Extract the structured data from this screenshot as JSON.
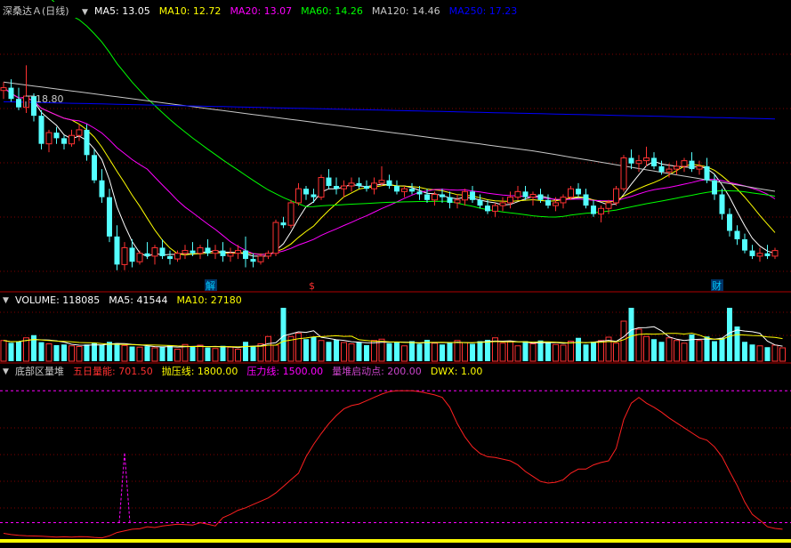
{
  "header": {
    "stock": "深桑达Ａ(日线)",
    "ma_labels": [
      {
        "label": "MA5: 13.05",
        "color": "#ffffff"
      },
      {
        "label": "MA10: 12.72",
        "color": "#ffff00"
      },
      {
        "label": "MA20: 13.07",
        "color": "#ff00ff"
      },
      {
        "label": "MA60: 14.26",
        "color": "#00ff00"
      },
      {
        "label": "MA120: 14.46",
        "color": "#c8c8c8"
      },
      {
        "label": "MA250: 17.23",
        "color": "#0000ff"
      }
    ]
  },
  "volume_header": [
    {
      "label": "VOLUME: 118085",
      "color": "#ffffff"
    },
    {
      "label": "MA5: 41544",
      "color": "#ffffff"
    },
    {
      "label": "MA10: 27180",
      "color": "#ffff00"
    }
  ],
  "indicator_header": [
    {
      "label": "底部区量堆",
      "color": "#c8c8c8"
    },
    {
      "label": "五日量能: 701.50",
      "color": "#ff3030"
    },
    {
      "label": "抛压线: 1800.00",
      "color": "#ffff00"
    },
    {
      "label": "压力线: 1500.00",
      "color": "#ff00ff"
    },
    {
      "label": "量堆启动点: 200.00",
      "color": "#cc44cc"
    },
    {
      "label": "DWX: 1.00",
      "color": "#ffff00"
    }
  ],
  "markers": [
    {
      "label": "解",
      "color": "#00ccff"
    },
    {
      "label": "$",
      "color": "#ff3030"
    },
    {
      "label": "财",
      "color": "#00ccff"
    }
  ],
  "colors": {
    "up": "#ff3232",
    "down": "#54ffff",
    "ma5": "#ffffff",
    "ma10": "#ffff00",
    "ma20": "#ff00ff",
    "ma60": "#00ff00",
    "ma120": "#c8c8c8",
    "ma250": "#0000ff",
    "grid": "#800000",
    "energy": "#ff2020",
    "pressure": "#ff00ff",
    "dwx": "#ffff00"
  },
  "chart_data": {
    "type": "candlestick",
    "high_label": "18.80",
    "price_ylim": [
      11.3,
      20.3
    ],
    "ohlc": [
      [
        17.9,
        18.2,
        17.6,
        18.0
      ],
      [
        18.0,
        18.3,
        17.5,
        17.6
      ],
      [
        17.6,
        18.0,
        17.2,
        17.3
      ],
      [
        17.3,
        18.8,
        17.1,
        17.7
      ],
      [
        17.7,
        17.8,
        16.8,
        17.0
      ],
      [
        17.0,
        17.2,
        15.8,
        16.0
      ],
      [
        16.0,
        16.5,
        15.7,
        16.4
      ],
      [
        16.4,
        16.6,
        16.0,
        16.2
      ],
      [
        16.2,
        16.3,
        15.8,
        16.0
      ],
      [
        16.0,
        16.5,
        15.9,
        16.3
      ],
      [
        16.3,
        16.7,
        16.1,
        16.5
      ],
      [
        16.5,
        16.7,
        15.4,
        15.6
      ],
      [
        15.6,
        15.8,
        14.6,
        14.7
      ],
      [
        14.7,
        15.1,
        13.9,
        14.1
      ],
      [
        14.1,
        14.4,
        12.5,
        12.7
      ],
      [
        12.7,
        13.1,
        11.5,
        11.7
      ],
      [
        11.7,
        12.5,
        11.5,
        12.3
      ],
      [
        12.3,
        12.6,
        11.6,
        11.8
      ],
      [
        11.8,
        12.2,
        11.7,
        12.1
      ],
      [
        12.1,
        12.5,
        11.9,
        12.0
      ],
      [
        12.0,
        12.4,
        11.7,
        12.3
      ],
      [
        12.3,
        12.6,
        11.9,
        12.0
      ],
      [
        12.0,
        12.2,
        11.7,
        11.9
      ],
      [
        11.9,
        12.2,
        11.8,
        12.1
      ],
      [
        12.1,
        12.4,
        11.9,
        12.2
      ],
      [
        12.2,
        12.5,
        12.0,
        12.1
      ],
      [
        12.1,
        12.4,
        11.9,
        12.3
      ],
      [
        12.3,
        12.6,
        12.0,
        12.1
      ],
      [
        12.1,
        12.4,
        11.9,
        12.2
      ],
      [
        12.2,
        12.5,
        11.8,
        12.0
      ],
      [
        12.0,
        12.3,
        11.8,
        12.1
      ],
      [
        12.1,
        12.4,
        11.9,
        12.2
      ],
      [
        12.2,
        12.7,
        11.6,
        11.9
      ],
      [
        11.9,
        12.1,
        11.6,
        11.8
      ],
      [
        11.8,
        12.1,
        11.7,
        12.0
      ],
      [
        12.0,
        12.2,
        11.9,
        12.1
      ],
      [
        12.1,
        13.3,
        12.0,
        13.2
      ],
      [
        13.2,
        13.4,
        13.0,
        13.1
      ],
      [
        13.1,
        14.0,
        13.0,
        13.9
      ],
      [
        13.9,
        14.6,
        13.8,
        14.4
      ],
      [
        14.4,
        14.5,
        14.0,
        14.2
      ],
      [
        14.2,
        14.4,
        13.9,
        14.1
      ],
      [
        14.1,
        14.9,
        14.0,
        14.8
      ],
      [
        14.8,
        15.1,
        14.4,
        14.5
      ],
      [
        14.5,
        14.8,
        14.2,
        14.4
      ],
      [
        14.4,
        14.7,
        14.1,
        14.5
      ],
      [
        14.5,
        14.8,
        14.3,
        14.6
      ],
      [
        14.6,
        14.8,
        14.4,
        14.5
      ],
      [
        14.5,
        14.7,
        14.3,
        14.4
      ],
      [
        14.4,
        14.8,
        14.2,
        14.6
      ],
      [
        14.6,
        15.2,
        14.5,
        14.7
      ],
      [
        14.7,
        14.9,
        14.4,
        14.5
      ],
      [
        14.5,
        14.7,
        14.2,
        14.3
      ],
      [
        14.3,
        14.5,
        14.1,
        14.4
      ],
      [
        14.4,
        14.6,
        14.2,
        14.3
      ],
      [
        14.3,
        14.5,
        14.0,
        14.2
      ],
      [
        14.2,
        14.4,
        13.9,
        14.0
      ],
      [
        14.0,
        14.3,
        13.8,
        14.2
      ],
      [
        14.2,
        14.4,
        13.9,
        14.1
      ],
      [
        14.1,
        14.3,
        13.7,
        13.9
      ],
      [
        13.9,
        14.2,
        13.7,
        14.0
      ],
      [
        14.0,
        14.4,
        13.8,
        14.3
      ],
      [
        14.3,
        14.5,
        13.9,
        14.0
      ],
      [
        14.0,
        14.2,
        13.7,
        13.8
      ],
      [
        13.8,
        14.0,
        13.5,
        13.6
      ],
      [
        13.6,
        13.9,
        13.4,
        13.8
      ],
      [
        13.8,
        14.1,
        13.6,
        13.9
      ],
      [
        13.9,
        14.3,
        13.7,
        14.1
      ],
      [
        14.1,
        14.5,
        14.0,
        14.3
      ],
      [
        14.3,
        14.5,
        14.0,
        14.1
      ],
      [
        14.1,
        14.3,
        13.8,
        14.2
      ],
      [
        14.2,
        14.4,
        13.9,
        14.0
      ],
      [
        14.0,
        14.2,
        13.7,
        13.8
      ],
      [
        13.8,
        14.1,
        13.6,
        13.9
      ],
      [
        13.9,
        14.2,
        13.7,
        14.1
      ],
      [
        14.1,
        14.5,
        14.0,
        14.4
      ],
      [
        14.4,
        14.6,
        14.1,
        14.2
      ],
      [
        14.2,
        14.4,
        13.7,
        13.8
      ],
      [
        13.8,
        14.0,
        13.4,
        13.5
      ],
      [
        13.5,
        13.8,
        13.2,
        13.7
      ],
      [
        13.7,
        14.0,
        13.5,
        13.9
      ],
      [
        13.9,
        14.5,
        13.8,
        14.4
      ],
      [
        14.4,
        15.6,
        14.3,
        15.5
      ],
      [
        15.5,
        15.8,
        15.1,
        15.3
      ],
      [
        15.3,
        15.6,
        15.0,
        15.4
      ],
      [
        15.4,
        15.9,
        15.2,
        15.5
      ],
      [
        15.5,
        15.7,
        15.1,
        15.2
      ],
      [
        15.2,
        15.4,
        14.9,
        15.0
      ],
      [
        15.0,
        15.3,
        14.8,
        15.1
      ],
      [
        15.1,
        15.4,
        14.9,
        15.2
      ],
      [
        15.2,
        15.5,
        15.0,
        15.4
      ],
      [
        15.4,
        15.7,
        15.0,
        15.1
      ],
      [
        15.1,
        15.4,
        14.9,
        15.2
      ],
      [
        15.2,
        15.5,
        14.6,
        14.7
      ],
      [
        14.7,
        14.9,
        14.0,
        14.2
      ],
      [
        14.2,
        14.4,
        13.3,
        13.5
      ],
      [
        13.5,
        13.7,
        12.7,
        12.9
      ],
      [
        12.9,
        13.1,
        12.4,
        12.6
      ],
      [
        12.6,
        12.8,
        12.1,
        12.2
      ],
      [
        12.2,
        12.4,
        11.9,
        12.0
      ],
      [
        12.0,
        12.3,
        11.8,
        12.1
      ],
      [
        12.1,
        12.4,
        11.9,
        12.0
      ],
      [
        12.0,
        12.3,
        11.9,
        12.2
      ]
    ],
    "volume": [
      62,
      55,
      60,
      70,
      78,
      57,
      52,
      48,
      50,
      46,
      44,
      50,
      55,
      49,
      58,
      54,
      47,
      44,
      42,
      45,
      40,
      44,
      47,
      36,
      50,
      44,
      48,
      41,
      38,
      46,
      42,
      36,
      58,
      44,
      52,
      74,
      48,
      160,
      74,
      84,
      66,
      72,
      62,
      58,
      64,
      56,
      52,
      56,
      48,
      62,
      66,
      54,
      58,
      46,
      60,
      52,
      64,
      54,
      50,
      56,
      62,
      56,
      52,
      60,
      64,
      70,
      54,
      58,
      46,
      60,
      52,
      62,
      56,
      50,
      48,
      60,
      70,
      50,
      58,
      62,
      72,
      54,
      120,
      160,
      96,
      74,
      66,
      58,
      70,
      62,
      54,
      80,
      62,
      74,
      60,
      70,
      160,
      104,
      58,
      50,
      46,
      42,
      48,
      40
    ],
    "volume_ylim": [
      0,
      160
    ],
    "indicator": {
      "series": [
        {
          "name": "五日量能",
          "values": [
            70,
            55,
            45,
            40,
            38,
            35,
            30,
            25,
            28,
            25,
            30,
            28,
            20,
            15,
            40,
            80,
            100,
            120,
            125,
            150,
            140,
            160,
            170,
            180,
            175,
            170,
            200,
            180,
            160,
            260,
            300,
            350,
            380,
            420,
            460,
            500,
            560,
            640,
            720,
            800,
            1000,
            1150,
            1280,
            1400,
            1500,
            1580,
            1620,
            1640,
            1680,
            1720,
            1760,
            1790,
            1800,
            1800,
            1800,
            1790,
            1770,
            1750,
            1720,
            1600,
            1400,
            1240,
            1120,
            1040,
            1000,
            990,
            970,
            950,
            900,
            820,
            760,
            700,
            680,
            690,
            720,
            800,
            850,
            850,
            900,
            930,
            950,
            1100,
            1450,
            1650,
            1720,
            1650,
            1600,
            1540,
            1470,
            1410,
            1350,
            1290,
            1230,
            1200,
            1120,
            1000,
            820,
            650,
            450,
            300,
            230,
            150,
            130,
            120
          ]
        }
      ],
      "ylim": [
        0,
        1900
      ],
      "lines": {
        "pressure": 1500,
        "throw": 1800,
        "start": 200,
        "dwx": 1
      },
      "spike_peak": 1050
    }
  }
}
